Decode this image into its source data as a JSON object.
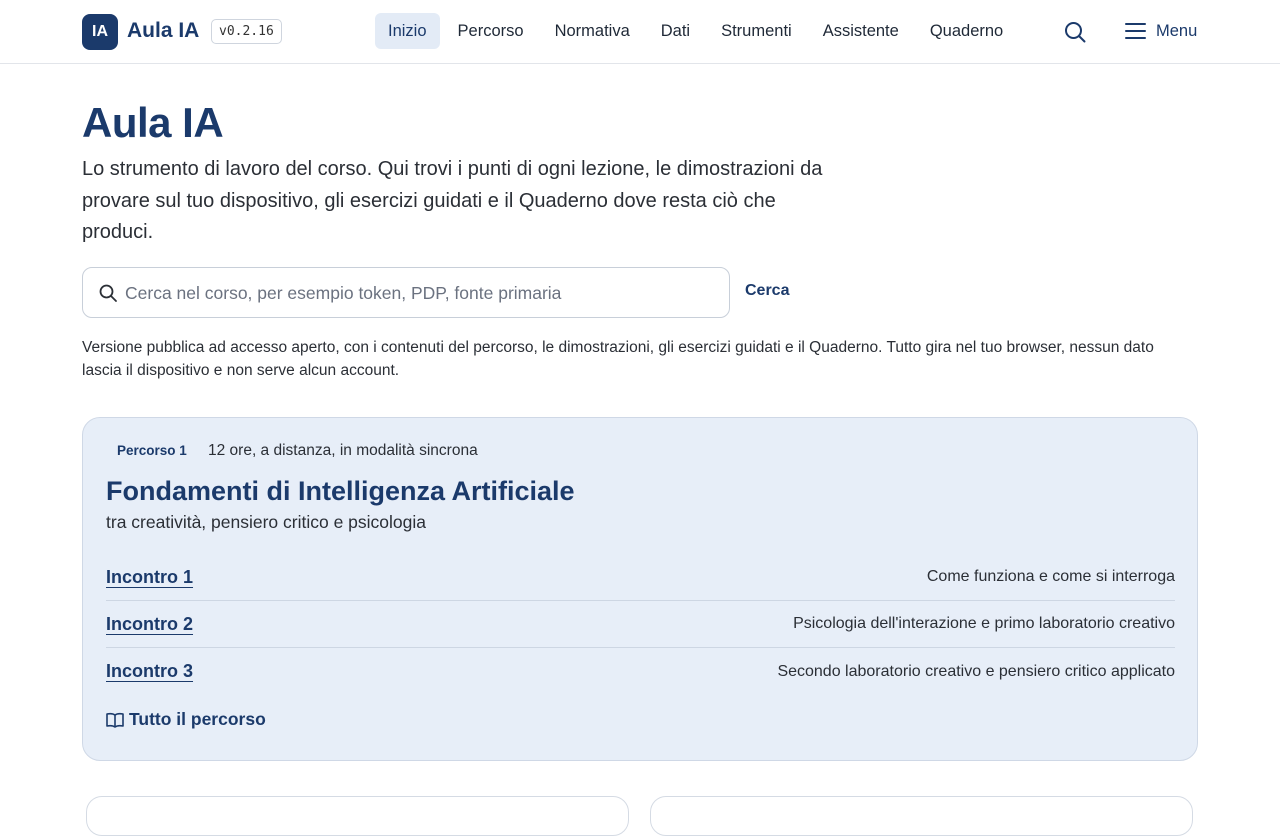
{
  "header": {
    "logo_badge": "IA",
    "brand": "Aula IA",
    "version": "v0.2.16",
    "nav": [
      {
        "label": "Inizio",
        "active": true
      },
      {
        "label": "Percorso"
      },
      {
        "label": "Normativa"
      },
      {
        "label": "Dati"
      },
      {
        "label": "Strumenti"
      },
      {
        "label": "Assistente"
      },
      {
        "label": "Quaderno"
      }
    ],
    "search_icon": "search-icon",
    "menu_label": "Menu"
  },
  "hero": {
    "title": "Aula IA",
    "intro": "Lo strumento di lavoro del corso. Qui trovi i punti di ogni lezione, le dimostrazioni da provare sul tuo dispositivo, gli esercizi guidati e il Quaderno dove resta ciò che produci.",
    "search_placeholder": "Cerca nel corso, per esempio token, PDP, fonte primaria",
    "search_value": "",
    "search_button": "Cerca",
    "notice": "Versione pubblica ad accesso aperto, con i contenuti del percorso, le dimostrazioni, gli esercizi guidati e il Quaderno. Tutto gira nel tuo browser, nessun dato lascia il dispositivo e non serve alcun account."
  },
  "course_card": {
    "tag": "Percorso 1",
    "meta": "12 ore, a distanza, in modalità sincrona",
    "title": "Fondamenti di Intelligenza Artificiale",
    "subtitle": "tra creatività, pensiero critico e psicologia",
    "meetings": [
      {
        "label": "Incontro 1",
        "desc": "Come funziona e come si interroga"
      },
      {
        "label": "Incontro 2",
        "desc": "Psicologia dell'interazione e primo laboratorio creativo"
      },
      {
        "label": "Incontro 3",
        "desc": "Secondo laboratorio creativo e pensiero critico applicato"
      }
    ],
    "full_path_label": "Tutto il percorso"
  },
  "colors": {
    "brand": "#1b3a6b",
    "card_bg": "#e7eef8",
    "nav_active_bg": "#e3ebf6"
  }
}
